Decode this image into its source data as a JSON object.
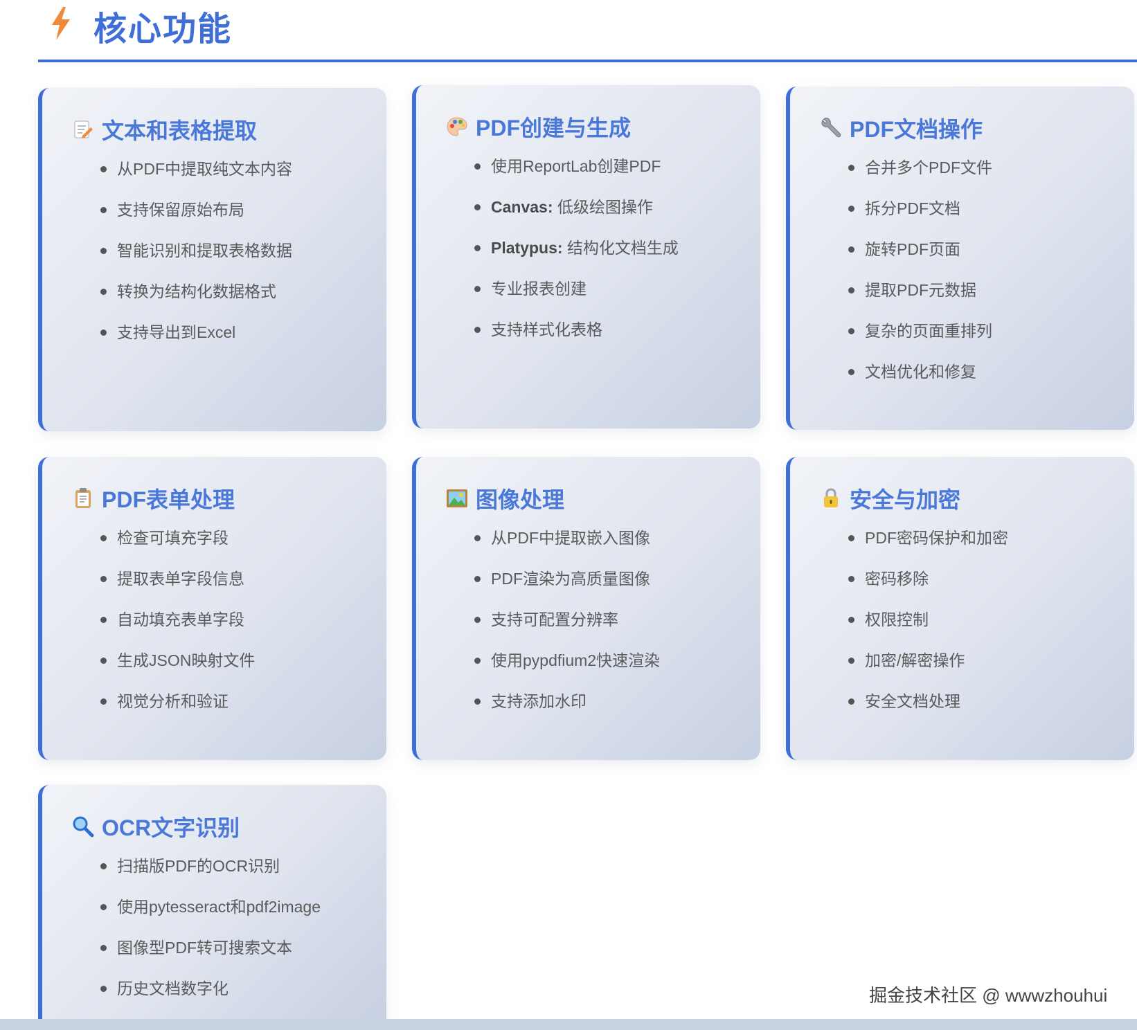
{
  "header": {
    "title": "核心功能",
    "icon": "lightning-bolt-icon",
    "accent": "#3f6fd6"
  },
  "cards": [
    {
      "title": "文本和表格提取",
      "icon": "memo-pencil-icon",
      "items": [
        {
          "label": "",
          "text": "从PDF中提取纯文本内容"
        },
        {
          "label": "",
          "text": "支持保留原始布局"
        },
        {
          "label": "",
          "text": "智能识别和提取表格数据"
        },
        {
          "label": "",
          "text": "转换为结构化数据格式"
        },
        {
          "label": "",
          "text": "支持导出到Excel"
        }
      ]
    },
    {
      "title": "PDF创建与生成",
      "icon": "palette-icon",
      "items": [
        {
          "label": "",
          "text": "使用ReportLab创建PDF"
        },
        {
          "label": "Canvas:",
          "text": " 低级绘图操作"
        },
        {
          "label": "Platypus:",
          "text": " 结构化文档生成"
        },
        {
          "label": "",
          "text": "专业报表创建"
        },
        {
          "label": "",
          "text": "支持样式化表格"
        }
      ]
    },
    {
      "title": "PDF文档操作",
      "icon": "wrench-icon",
      "items": [
        {
          "label": "",
          "text": "合并多个PDF文件"
        },
        {
          "label": "",
          "text": "拆分PDF文档"
        },
        {
          "label": "",
          "text": "旋转PDF页面"
        },
        {
          "label": "",
          "text": "提取PDF元数据"
        },
        {
          "label": "",
          "text": "复杂的页面重排列"
        },
        {
          "label": "",
          "text": "文档优化和修复"
        }
      ]
    },
    {
      "title": "PDF表单处理",
      "icon": "clipboard-icon",
      "items": [
        {
          "label": "",
          "text": "检查可填充字段"
        },
        {
          "label": "",
          "text": "提取表单字段信息"
        },
        {
          "label": "",
          "text": "自动填充表单字段"
        },
        {
          "label": "",
          "text": "生成JSON映射文件"
        },
        {
          "label": "",
          "text": "视觉分析和验证"
        }
      ]
    },
    {
      "title": "图像处理",
      "icon": "landscape-picture-icon",
      "items": [
        {
          "label": "",
          "text": "从PDF中提取嵌入图像"
        },
        {
          "label": "",
          "text": "PDF渲染为高质量图像"
        },
        {
          "label": "",
          "text": "支持可配置分辨率"
        },
        {
          "label": "",
          "text": "使用pypdfium2快速渲染"
        },
        {
          "label": "",
          "text": "支持添加水印"
        }
      ]
    },
    {
      "title": "安全与加密",
      "icon": "lock-icon",
      "items": [
        {
          "label": "",
          "text": "PDF密码保护和加密"
        },
        {
          "label": "",
          "text": "密码移除"
        },
        {
          "label": "",
          "text": "权限控制"
        },
        {
          "label": "",
          "text": "加密/解密操作"
        },
        {
          "label": "",
          "text": "安全文档处理"
        }
      ]
    },
    {
      "title": "OCR文字识别",
      "icon": "magnifier-icon",
      "items": [
        {
          "label": "",
          "text": "扫描版PDF的OCR识别"
        },
        {
          "label": "",
          "text": "使用pytesseract和pdf2image"
        },
        {
          "label": "",
          "text": "图像型PDF转可搜索文本"
        },
        {
          "label": "",
          "text": "历史文档数字化"
        }
      ]
    }
  ],
  "watermark": "掘金技术社区 @ wwwzhouhui"
}
